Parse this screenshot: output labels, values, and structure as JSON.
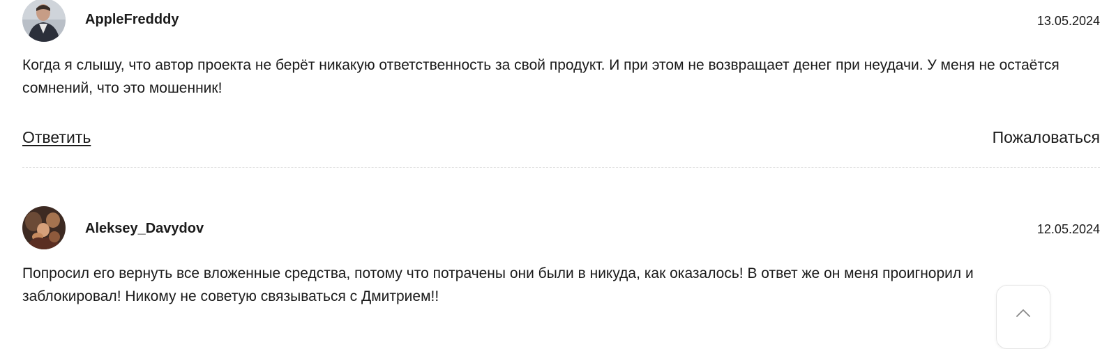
{
  "comments": [
    {
      "author": "AppleFredddy",
      "date": "13.05.2024",
      "text": "Когда я слышу, что автор проекта не берёт никакую ответственность за свой продукт. И при этом не возвращает денег при неудачи. У меня не остаётся сомнений, что это мошенник!",
      "reply_label": "Ответить",
      "report_label": "Пожаловаться",
      "avatar_icon": "user-photo-avatar"
    },
    {
      "author": "Aleksey_Davydov",
      "date": "12.05.2024",
      "text": "Попросил его вернуть все вложенные средства, потому что потрачены они были в никуда, как оказалось! В ответ же он меня проигнорил и заблокировал! Никому не советую связываться с Дмитрием!!",
      "avatar_icon": "user-photo-avatar"
    }
  ],
  "scroll_top": {
    "icon": "chevron-up-icon"
  },
  "colors": {
    "text": "#1a1a1a",
    "divider": "#e2e2e2"
  }
}
